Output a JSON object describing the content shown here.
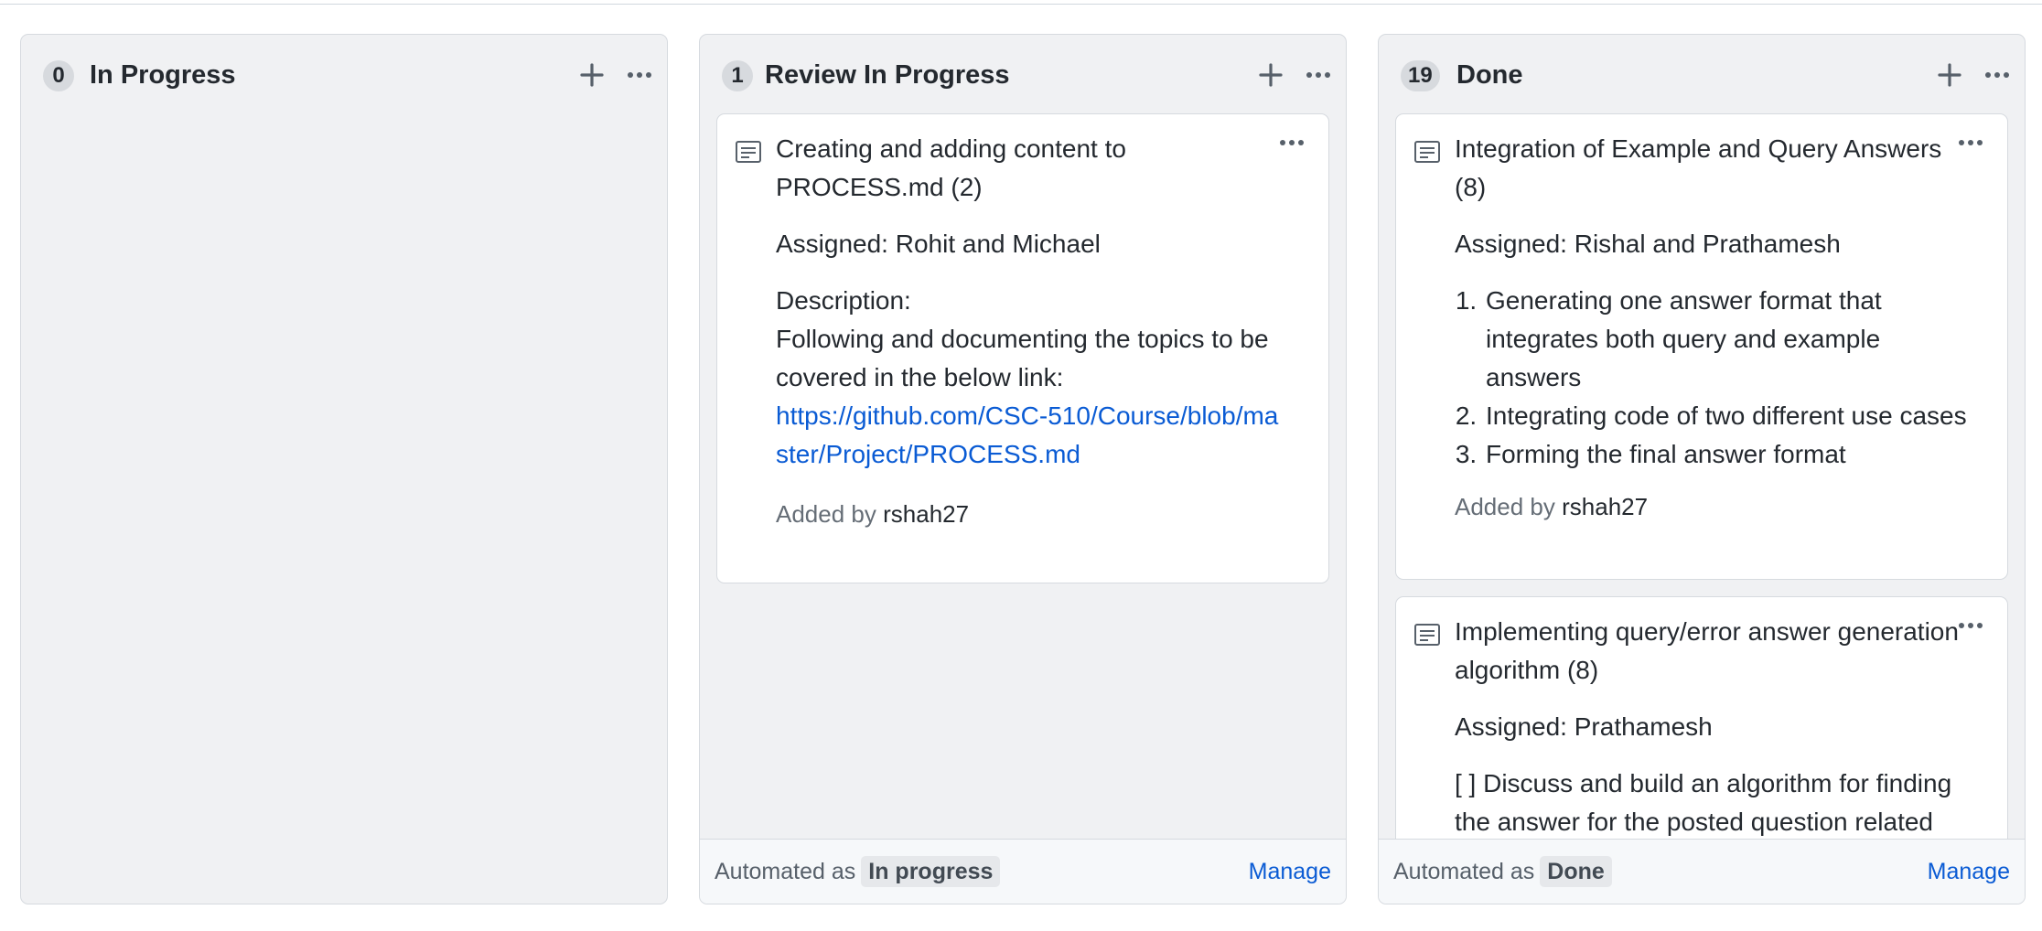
{
  "columns": [
    {
      "count": "0",
      "title": "In Progress",
      "cards": []
    },
    {
      "count": "1",
      "title": "Review In Progress",
      "cards": [
        {
          "title": "Creating and adding content to PROCESS.md (2)",
          "assigned": "Assigned: Rohit and Michael",
          "description_label": "Description:",
          "description_text": "Following and documenting the topics to be covered in the below link:",
          "link": "https://github.com/CSC-510/Course/blob/master/Project/PROCESS.md",
          "added_by_label": "Added by",
          "added_by_user": "rshah27"
        }
      ],
      "automation": {
        "label": "Automated as",
        "state": "In progress",
        "manage": "Manage"
      }
    },
    {
      "count": "19",
      "title": "Done",
      "cards": [
        {
          "title": "Integration of Example and Query Answers (8)",
          "assigned": "Assigned: Rishal and Prathamesh",
          "steps": [
            "Generating one answer format that integrates both query and example answers",
            "Integrating code of two different use cases",
            "Forming the final answer format"
          ],
          "added_by_label": "Added by",
          "added_by_user": "rshah27"
        },
        {
          "title": "Implementing query/error answer generation algorithm (8)",
          "assigned": "Assigned: Prathamesh",
          "task": "[ ] Discuss and build an algorithm for finding the answer for the posted question related"
        }
      ],
      "automation": {
        "label": "Automated as",
        "state": "Done",
        "manage": "Manage"
      }
    }
  ],
  "icons": {
    "add": "plus-icon",
    "menu": "kebab-horizontal-icon",
    "note": "note-icon"
  },
  "colors": {
    "column_bg": "#f0f1f3",
    "link": "#0a5bd4",
    "badge_bg": "#d7dade"
  }
}
